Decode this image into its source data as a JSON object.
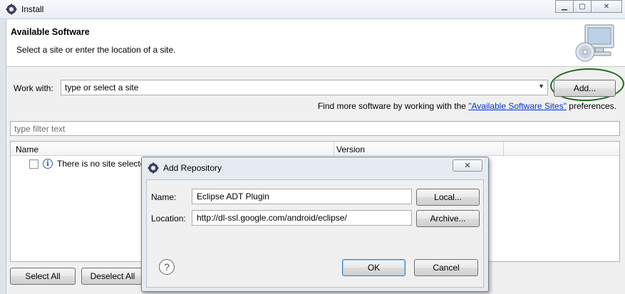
{
  "window": {
    "title": "Install",
    "icon": "eclipse-gear-icon"
  },
  "header": {
    "title": "Available Software",
    "subtitle": "Select a site or enter the location of a site.",
    "graphic": "computer-cd-icon"
  },
  "work_with": {
    "label": "Work with:",
    "value": "type or select a site",
    "add_button": "Add...",
    "highlight_color": "#1e6b1e"
  },
  "more_software": {
    "prefix": "Find more software by working with the ",
    "link": "\"Available Software Sites\"",
    "suffix": " preferences."
  },
  "filter": {
    "placeholder": "type filter text"
  },
  "table": {
    "columns": [
      "Name",
      "Version"
    ],
    "rows": [
      {
        "checked": false,
        "icon": "info-icon",
        "name": "There is no site selected."
      }
    ]
  },
  "buttons": {
    "select_all": "Select All",
    "deselect_all": "Deselect All"
  },
  "dialog": {
    "title": "Add Repository",
    "name_label": "Name:",
    "name_value": "Eclipse ADT Plugin",
    "location_label": "Location:",
    "location_value": "http://dl-ssl.google.com/android/eclipse/",
    "local_button": "Local...",
    "archive_button": "Archive...",
    "ok_button": "OK",
    "cancel_button": "Cancel",
    "close_glyph": "✕",
    "help_glyph": "?"
  }
}
